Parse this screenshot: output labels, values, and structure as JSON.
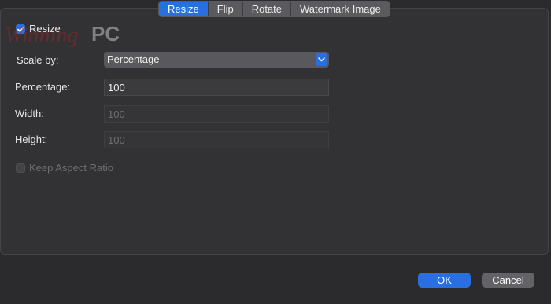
{
  "tabs": [
    {
      "label": "Resize",
      "active": true
    },
    {
      "label": "Flip",
      "active": false
    },
    {
      "label": "Rotate",
      "active": false
    },
    {
      "label": "Watermark Image",
      "active": false
    }
  ],
  "watermark": {
    "text_script": "Winning",
    "text_pc": "PC"
  },
  "resize": {
    "label": "Resize",
    "checked": true
  },
  "scale_by": {
    "label": "Scale by:",
    "value": "Percentage"
  },
  "percentage": {
    "label": "Percentage:",
    "value": "100"
  },
  "width": {
    "label": "Width:",
    "value": "100"
  },
  "height": {
    "label": "Height:",
    "value": "100"
  },
  "keep_aspect": {
    "label": "Keep Aspect Ratio",
    "checked": false
  },
  "buttons": {
    "ok": "OK",
    "cancel": "Cancel"
  },
  "colors": {
    "accent": "#2a6fe0",
    "background": "#2b2b2d"
  }
}
